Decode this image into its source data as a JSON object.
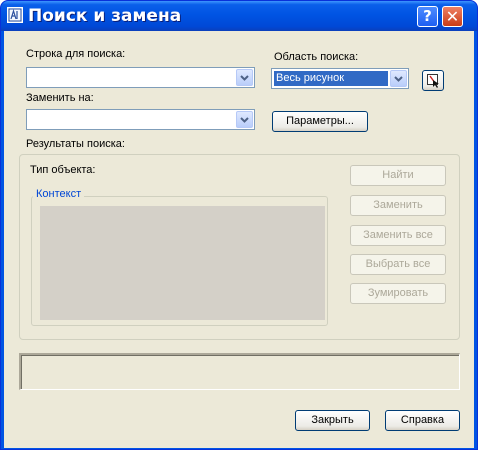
{
  "window": {
    "title": "Поиск и замена",
    "help_label": "?",
    "close_label": "✕",
    "colors": {
      "titlebar": "#0054e3",
      "face": "#ece9d8",
      "selection": "#316ac5"
    }
  },
  "find": {
    "label": "Строка для поиска:",
    "value": ""
  },
  "replace": {
    "label": "Заменить на:",
    "value": ""
  },
  "scope": {
    "label": "Область поиска:",
    "selected": "Весь рисунок"
  },
  "buttons": {
    "options": "Параметры...",
    "find": "Найти",
    "replace": "Заменить",
    "replace_all": "Заменить все",
    "select_all": "Выбрать все",
    "zoom": "Зумировать",
    "close": "Закрыть",
    "help": "Справка"
  },
  "results": {
    "label": "Результаты поиска:",
    "object_type_label": "Тип объекта:",
    "context_label": "Контекст"
  },
  "icons": {
    "app": "autocad-app-icon",
    "dropdown": "chevron-down-icon",
    "pick": "select-objects-icon"
  }
}
